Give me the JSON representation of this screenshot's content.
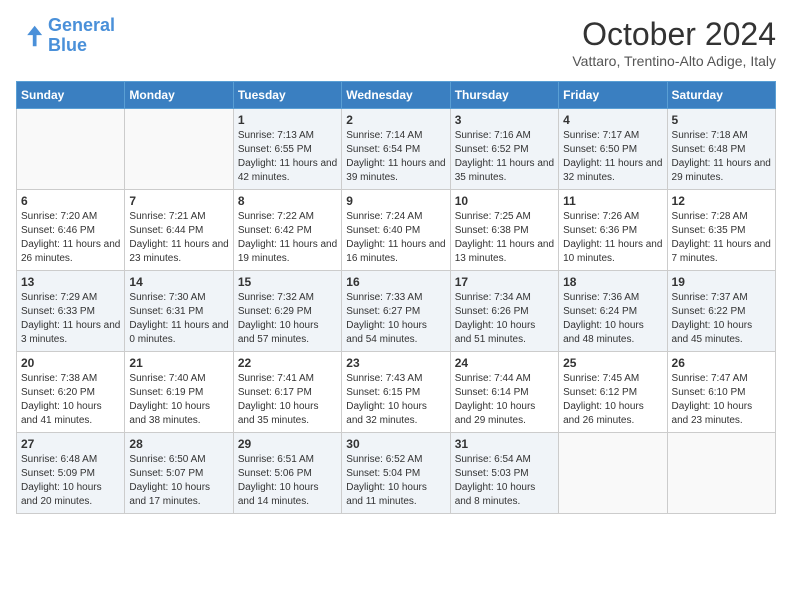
{
  "header": {
    "logo_general": "General",
    "logo_blue": "Blue",
    "month_title": "October 2024",
    "subtitle": "Vattaro, Trentino-Alto Adige, Italy"
  },
  "days_of_week": [
    "Sunday",
    "Monday",
    "Tuesday",
    "Wednesday",
    "Thursday",
    "Friday",
    "Saturday"
  ],
  "weeks": [
    [
      {
        "day": "",
        "sunrise": "",
        "sunset": "",
        "daylight": ""
      },
      {
        "day": "",
        "sunrise": "",
        "sunset": "",
        "daylight": ""
      },
      {
        "day": "1",
        "sunrise": "Sunrise: 7:13 AM",
        "sunset": "Sunset: 6:55 PM",
        "daylight": "Daylight: 11 hours and 42 minutes."
      },
      {
        "day": "2",
        "sunrise": "Sunrise: 7:14 AM",
        "sunset": "Sunset: 6:54 PM",
        "daylight": "Daylight: 11 hours and 39 minutes."
      },
      {
        "day": "3",
        "sunrise": "Sunrise: 7:16 AM",
        "sunset": "Sunset: 6:52 PM",
        "daylight": "Daylight: 11 hours and 35 minutes."
      },
      {
        "day": "4",
        "sunrise": "Sunrise: 7:17 AM",
        "sunset": "Sunset: 6:50 PM",
        "daylight": "Daylight: 11 hours and 32 minutes."
      },
      {
        "day": "5",
        "sunrise": "Sunrise: 7:18 AM",
        "sunset": "Sunset: 6:48 PM",
        "daylight": "Daylight: 11 hours and 29 minutes."
      }
    ],
    [
      {
        "day": "6",
        "sunrise": "Sunrise: 7:20 AM",
        "sunset": "Sunset: 6:46 PM",
        "daylight": "Daylight: 11 hours and 26 minutes."
      },
      {
        "day": "7",
        "sunrise": "Sunrise: 7:21 AM",
        "sunset": "Sunset: 6:44 PM",
        "daylight": "Daylight: 11 hours and 23 minutes."
      },
      {
        "day": "8",
        "sunrise": "Sunrise: 7:22 AM",
        "sunset": "Sunset: 6:42 PM",
        "daylight": "Daylight: 11 hours and 19 minutes."
      },
      {
        "day": "9",
        "sunrise": "Sunrise: 7:24 AM",
        "sunset": "Sunset: 6:40 PM",
        "daylight": "Daylight: 11 hours and 16 minutes."
      },
      {
        "day": "10",
        "sunrise": "Sunrise: 7:25 AM",
        "sunset": "Sunset: 6:38 PM",
        "daylight": "Daylight: 11 hours and 13 minutes."
      },
      {
        "day": "11",
        "sunrise": "Sunrise: 7:26 AM",
        "sunset": "Sunset: 6:36 PM",
        "daylight": "Daylight: 11 hours and 10 minutes."
      },
      {
        "day": "12",
        "sunrise": "Sunrise: 7:28 AM",
        "sunset": "Sunset: 6:35 PM",
        "daylight": "Daylight: 11 hours and 7 minutes."
      }
    ],
    [
      {
        "day": "13",
        "sunrise": "Sunrise: 7:29 AM",
        "sunset": "Sunset: 6:33 PM",
        "daylight": "Daylight: 11 hours and 3 minutes."
      },
      {
        "day": "14",
        "sunrise": "Sunrise: 7:30 AM",
        "sunset": "Sunset: 6:31 PM",
        "daylight": "Daylight: 11 hours and 0 minutes."
      },
      {
        "day": "15",
        "sunrise": "Sunrise: 7:32 AM",
        "sunset": "Sunset: 6:29 PM",
        "daylight": "Daylight: 10 hours and 57 minutes."
      },
      {
        "day": "16",
        "sunrise": "Sunrise: 7:33 AM",
        "sunset": "Sunset: 6:27 PM",
        "daylight": "Daylight: 10 hours and 54 minutes."
      },
      {
        "day": "17",
        "sunrise": "Sunrise: 7:34 AM",
        "sunset": "Sunset: 6:26 PM",
        "daylight": "Daylight: 10 hours and 51 minutes."
      },
      {
        "day": "18",
        "sunrise": "Sunrise: 7:36 AM",
        "sunset": "Sunset: 6:24 PM",
        "daylight": "Daylight: 10 hours and 48 minutes."
      },
      {
        "day": "19",
        "sunrise": "Sunrise: 7:37 AM",
        "sunset": "Sunset: 6:22 PM",
        "daylight": "Daylight: 10 hours and 45 minutes."
      }
    ],
    [
      {
        "day": "20",
        "sunrise": "Sunrise: 7:38 AM",
        "sunset": "Sunset: 6:20 PM",
        "daylight": "Daylight: 10 hours and 41 minutes."
      },
      {
        "day": "21",
        "sunrise": "Sunrise: 7:40 AM",
        "sunset": "Sunset: 6:19 PM",
        "daylight": "Daylight: 10 hours and 38 minutes."
      },
      {
        "day": "22",
        "sunrise": "Sunrise: 7:41 AM",
        "sunset": "Sunset: 6:17 PM",
        "daylight": "Daylight: 10 hours and 35 minutes."
      },
      {
        "day": "23",
        "sunrise": "Sunrise: 7:43 AM",
        "sunset": "Sunset: 6:15 PM",
        "daylight": "Daylight: 10 hours and 32 minutes."
      },
      {
        "day": "24",
        "sunrise": "Sunrise: 7:44 AM",
        "sunset": "Sunset: 6:14 PM",
        "daylight": "Daylight: 10 hours and 29 minutes."
      },
      {
        "day": "25",
        "sunrise": "Sunrise: 7:45 AM",
        "sunset": "Sunset: 6:12 PM",
        "daylight": "Daylight: 10 hours and 26 minutes."
      },
      {
        "day": "26",
        "sunrise": "Sunrise: 7:47 AM",
        "sunset": "Sunset: 6:10 PM",
        "daylight": "Daylight: 10 hours and 23 minutes."
      }
    ],
    [
      {
        "day": "27",
        "sunrise": "Sunrise: 6:48 AM",
        "sunset": "Sunset: 5:09 PM",
        "daylight": "Daylight: 10 hours and 20 minutes."
      },
      {
        "day": "28",
        "sunrise": "Sunrise: 6:50 AM",
        "sunset": "Sunset: 5:07 PM",
        "daylight": "Daylight: 10 hours and 17 minutes."
      },
      {
        "day": "29",
        "sunrise": "Sunrise: 6:51 AM",
        "sunset": "Sunset: 5:06 PM",
        "daylight": "Daylight: 10 hours and 14 minutes."
      },
      {
        "day": "30",
        "sunrise": "Sunrise: 6:52 AM",
        "sunset": "Sunset: 5:04 PM",
        "daylight": "Daylight: 10 hours and 11 minutes."
      },
      {
        "day": "31",
        "sunrise": "Sunrise: 6:54 AM",
        "sunset": "Sunset: 5:03 PM",
        "daylight": "Daylight: 10 hours and 8 minutes."
      },
      {
        "day": "",
        "sunrise": "",
        "sunset": "",
        "daylight": ""
      },
      {
        "day": "",
        "sunrise": "",
        "sunset": "",
        "daylight": ""
      }
    ]
  ]
}
